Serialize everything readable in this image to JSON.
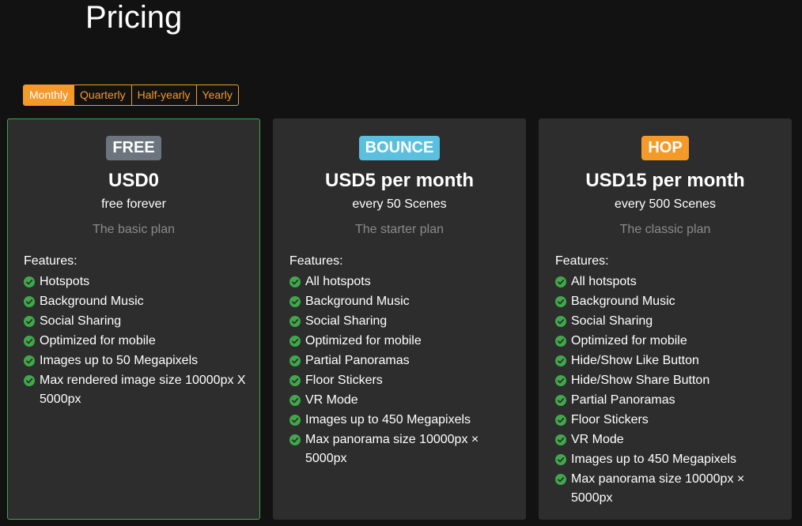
{
  "page": {
    "title": "Pricing"
  },
  "billing_periods": [
    {
      "label": "Monthly",
      "active": true
    },
    {
      "label": "Quarterly",
      "active": false
    },
    {
      "label": "Half-yearly",
      "active": false
    },
    {
      "label": "Yearly",
      "active": false
    }
  ],
  "colors": {
    "accent_orange": "#f39a2b",
    "selected_border": "#3fa84a",
    "check_green": "#3fa84a",
    "badge_free": "#6c757d",
    "badge_bounce": "#5bc0de",
    "badge_hop": "#f39a2b"
  },
  "icons": {
    "feature_check": "check-circle-icon"
  },
  "plans": [
    {
      "badge": "FREE",
      "price": "USD0",
      "billing": "free forever",
      "description": "The basic plan",
      "features_heading": "Features:",
      "features": [
        "Hotspots",
        "Background Music",
        "Social Sharing",
        "Optimized for mobile",
        "Images up to 50 Megapixels",
        "Max rendered image size 10000px X 5000px"
      ]
    },
    {
      "badge": "BOUNCE",
      "price": "USD5 per month",
      "billing": "every 50 Scenes",
      "description": "The starter plan",
      "features_heading": "Features:",
      "features": [
        "All hotspots",
        "Background Music",
        "Social Sharing",
        "Optimized for mobile",
        "Partial Panoramas",
        "Floor Stickers",
        "VR Mode",
        "Images up to 450 Megapixels",
        "Max panorama size 10000px × 5000px"
      ]
    },
    {
      "badge": "HOP",
      "price": "USD15 per month",
      "billing": "every 500 Scenes",
      "description": "The classic plan",
      "features_heading": "Features:",
      "features": [
        "All hotspots",
        "Background Music",
        "Social Sharing",
        "Optimized for mobile",
        "Hide/Show Like Button",
        "Hide/Show Share Button",
        "Partial Panoramas",
        "Floor Stickers",
        "VR Mode",
        "Images up to 450 Megapixels",
        "Max panorama size 10000px × 5000px"
      ]
    }
  ]
}
